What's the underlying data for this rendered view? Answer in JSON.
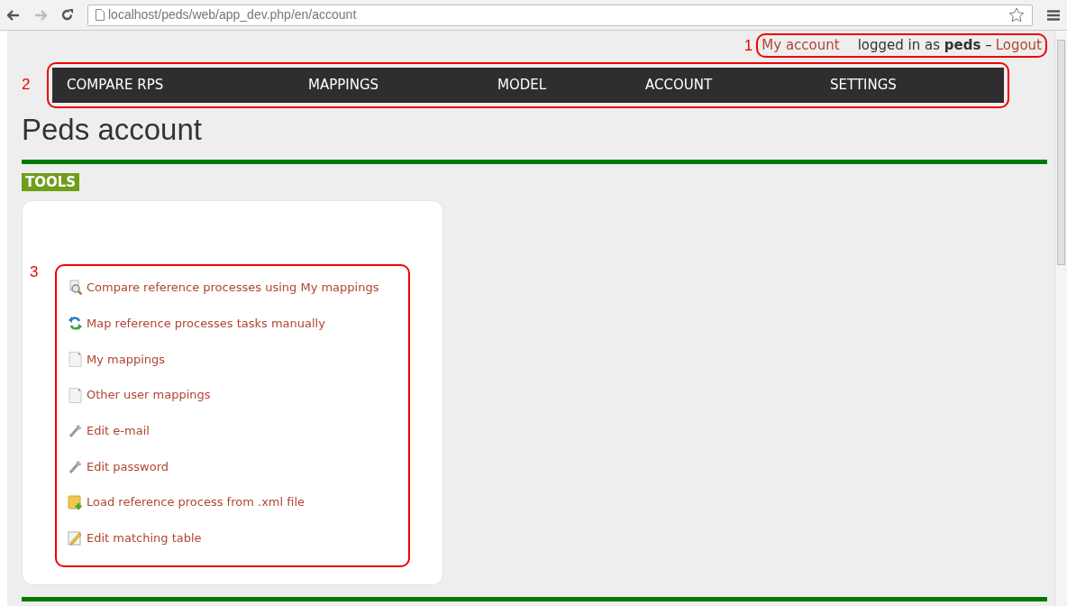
{
  "browser": {
    "url": "localhost/peds/web/app_dev.php/en/account"
  },
  "user_bar": {
    "marker": "1",
    "account_link": "My account",
    "logged_in_text": "logged in as",
    "username": "peds",
    "separator": "–",
    "logout_link": "Logout"
  },
  "nav": {
    "marker": "2",
    "items": [
      {
        "label": "COMPARE RPS"
      },
      {
        "label": "MAPPINGS"
      },
      {
        "label": "MODEL"
      },
      {
        "label": "ACCOUNT"
      },
      {
        "label": "SETTINGS"
      }
    ]
  },
  "page_title": "Peds account",
  "tools": {
    "heading": "TOOLS",
    "marker": "3",
    "items": [
      {
        "kind": "search",
        "label": "Compare reference processes using My mappings"
      },
      {
        "kind": "swap",
        "label": "Map reference processes tasks manually"
      },
      {
        "kind": "page",
        "label": "My mappings"
      },
      {
        "kind": "page",
        "label": "Other user mappings"
      },
      {
        "kind": "wrench",
        "label": "Edit e-mail"
      },
      {
        "kind": "wrench",
        "label": "Edit password"
      },
      {
        "kind": "folder-add",
        "label": "Load reference process from .xml file"
      },
      {
        "kind": "pencil",
        "label": "Edit matching table"
      }
    ]
  }
}
